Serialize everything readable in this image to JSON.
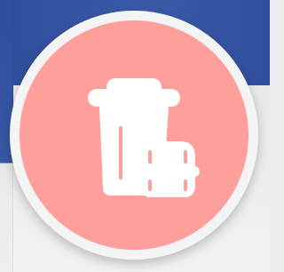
{
  "icon": {
    "name": "takeaway-food-icon",
    "badge_color": "#ff9f9c",
    "ring_color": "#f4f4f4",
    "icon_color": "#ffffff",
    "background_blue": "#3858a7"
  }
}
